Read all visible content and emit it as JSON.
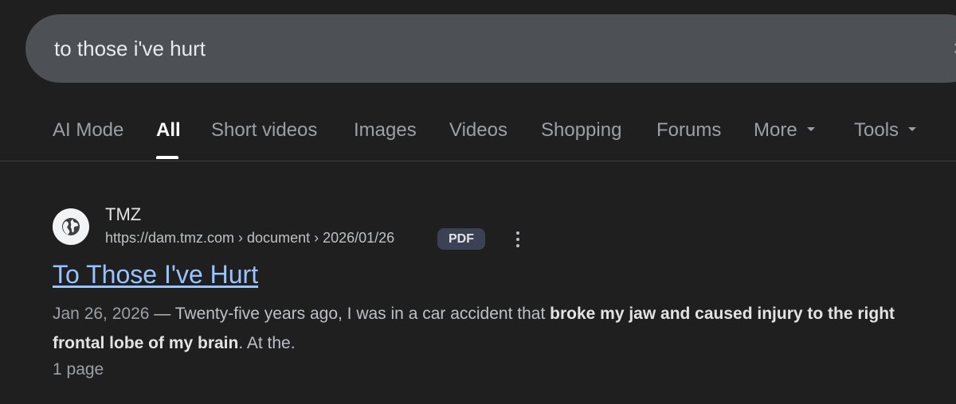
{
  "search": {
    "query": "to those i've hurt",
    "clear_symbol": "×"
  },
  "tabs": {
    "items": [
      {
        "label": "AI Mode"
      },
      {
        "label": "All"
      },
      {
        "label": "Short videos"
      },
      {
        "label": "Images"
      },
      {
        "label": "Videos"
      },
      {
        "label": "Shopping"
      },
      {
        "label": "Forums"
      },
      {
        "label": "More"
      },
      {
        "label": "Tools"
      }
    ],
    "active": "All"
  },
  "result": {
    "favicon_icon": "globe-icon",
    "site_name": "TMZ",
    "breadcrumb": "https://dam.tmz.com › document › 2026/01/26",
    "file_type": "PDF",
    "title": "To Those I've Hurt",
    "snippet": {
      "date": "Jan 26, 2026",
      "sep": " — ",
      "text1": "Twenty-five years ago, I was in a car accident that ",
      "bold": "broke my jaw and caused injury to the right frontal lobe of my brain",
      "text2": ". At the."
    },
    "pages": "1 page"
  },
  "colors": {
    "background": "#1f1f1f",
    "search_box": "#4d5156",
    "link": "#99c3ff",
    "badge": "#3c4256"
  }
}
